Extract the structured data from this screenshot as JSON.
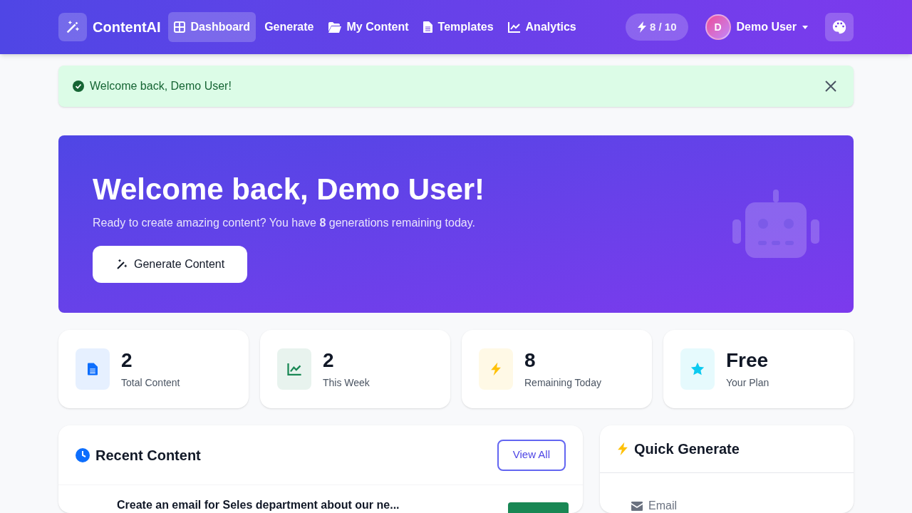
{
  "brand": {
    "name": "ContentAI"
  },
  "nav": [
    {
      "label": "Dashboard",
      "selected": true
    },
    {
      "label": "Generate",
      "selected": false
    },
    {
      "label": "My Content",
      "selected": false
    },
    {
      "label": "Templates",
      "selected": false
    },
    {
      "label": "Analytics",
      "selected": false
    }
  ],
  "usage": {
    "text": "8 / 10"
  },
  "user": {
    "initial": "D",
    "name": "Demo User"
  },
  "alert": {
    "text": "Welcome back, Demo User!"
  },
  "hero": {
    "title": "Welcome back, Demo User!",
    "subtitle": "Ready to create amazing content? You have **8** generations remaining today.",
    "button": "Generate Content"
  },
  "stats": [
    {
      "value": "2",
      "label": "Total Content",
      "color": "#0d6efd"
    },
    {
      "value": "2",
      "label": "This Week",
      "color": "#198754"
    },
    {
      "value": "8",
      "label": "Remaining Today",
      "color": "#ffc107"
    },
    {
      "value": "Free",
      "label": "Your Plan",
      "color": "#0dcaf0"
    }
  ],
  "recent": {
    "title": "Recent Content",
    "button": "View All",
    "items": [
      {
        "title": "Create an email for Seles department about our ne..."
      }
    ]
  },
  "quick": {
    "title": "Quick Generate",
    "items": [
      {
        "label": "Email"
      }
    ]
  }
}
